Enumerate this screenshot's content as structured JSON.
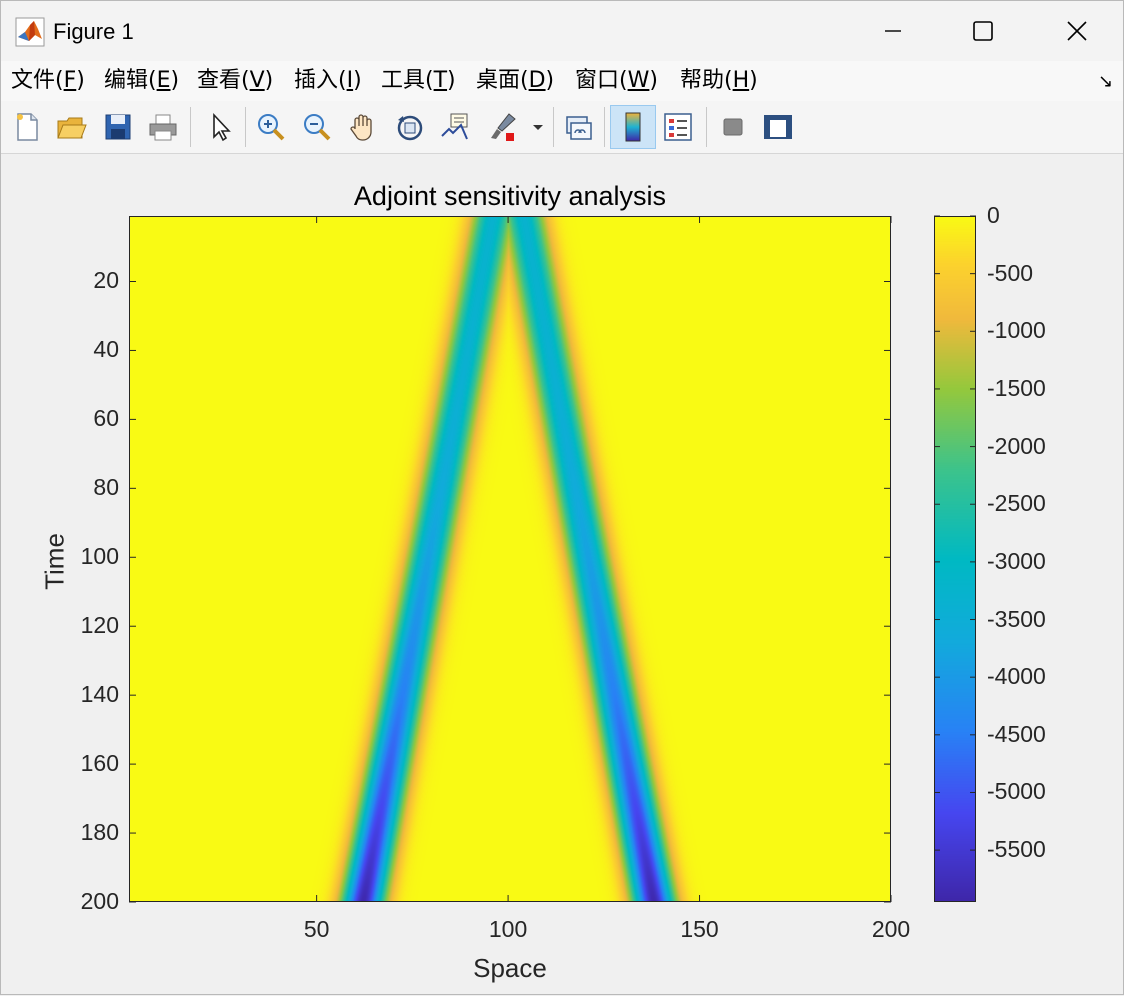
{
  "window": {
    "title": "Figure 1",
    "icon": "matlab-logo-icon",
    "controls": [
      "minimize-icon",
      "maximize-icon",
      "close-icon"
    ]
  },
  "menu": [
    {
      "label": "文件(",
      "key": "F",
      "tail": ")"
    },
    {
      "label": "编辑(",
      "key": "E",
      "tail": ")"
    },
    {
      "label": "查看(",
      "key": "V",
      "tail": ")"
    },
    {
      "label": "插入(",
      "key": "I",
      "tail": ")"
    },
    {
      "label": "工具(",
      "key": "T",
      "tail": ")"
    },
    {
      "label": "桌面(",
      "key": "D",
      "tail": ")"
    },
    {
      "label": "窗口(",
      "key": "W",
      "tail": ")"
    },
    {
      "label": "帮助(",
      "key": "H",
      "tail": ")"
    }
  ],
  "toolbar": {
    "icons": [
      "new-figure-icon",
      "open-icon",
      "save-icon",
      "print-icon",
      "select-arrow-icon",
      "zoom-in-icon",
      "zoom-out-icon",
      "pan-hand-icon",
      "rotate-3d-icon",
      "data-cursor-icon",
      "brush-icon",
      "brush-dropdown-icon",
      "link-plot-icon",
      "colorbar-icon",
      "legend-icon",
      "hide-plot-tools-icon",
      "show-plot-tools-icon"
    ],
    "active": "colorbar-icon"
  },
  "chart_data": {
    "type": "heatmap",
    "title": "Adjoint sensitivity analysis",
    "xlabel": "Space",
    "ylabel": "Time",
    "xlim": [
      1,
      200
    ],
    "ylim": [
      1,
      200
    ],
    "y_reversed": true,
    "x_ticks": [
      50,
      100,
      150,
      200
    ],
    "y_ticks": [
      20,
      40,
      60,
      80,
      100,
      120,
      140,
      160,
      180,
      200
    ],
    "colormap": "parula",
    "clim": [
      -5950,
      0
    ],
    "colorbar_ticks": [
      0,
      -500,
      -1000,
      -1500,
      -2000,
      -2500,
      -3000,
      -3500,
      -4000,
      -4500,
      -5000,
      -5500
    ],
    "colorbar_labels": [
      "0",
      "-500",
      "-1000",
      "-1500",
      "-2000",
      "-2500",
      "-3000",
      "-3500",
      "-4000",
      "-4500",
      "-5000",
      "-5500"
    ],
    "bands": [
      {
        "x_at_time_1": 96,
        "x_at_time_200": 62,
        "core_value_time_1": -3300,
        "core_value_time_200": -5900,
        "half_width": 5
      },
      {
        "x_at_time_1": 104,
        "x_at_time_200": 138,
        "core_value_time_1": -3300,
        "core_value_time_200": -5900,
        "half_width": 5
      }
    ],
    "background_value": 0
  }
}
